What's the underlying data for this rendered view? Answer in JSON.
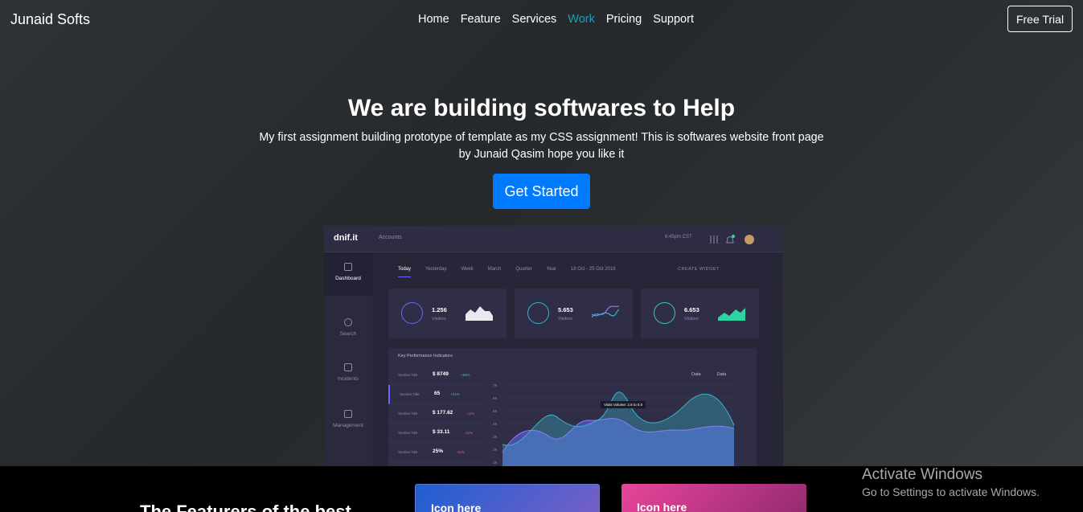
{
  "nav": {
    "brand": "Junaid Softs",
    "items": [
      "Home",
      "Feature",
      "Services",
      "Work",
      "Pricing",
      "Support"
    ],
    "active_item": "Work",
    "trial_label": "Free Trial"
  },
  "hero": {
    "title": "We are building softwares to Help",
    "subtitle": "My first assignment building prototype of template as my CSS assignment! This is softwares website front page by Junaid Qasim hope you like it",
    "cta_label": "Get Started"
  },
  "dashboard": {
    "logo": "dnif.it",
    "breadcrumb": "Accounts",
    "time": "6:45pm CST",
    "sidebar": [
      "Dashboard",
      "Search",
      "Incidents",
      "Management"
    ],
    "tabs": [
      "Today",
      "Yesterday",
      "Week",
      "March",
      "Quarter",
      "Year"
    ],
    "date_range": "18 Oct - 25 Oct 2018",
    "widget_button": "CREATE WIDGET",
    "cards": [
      {
        "value": "1.256",
        "label": "Visitors",
        "color": "#6c63ff"
      },
      {
        "value": "5.653",
        "label": "Visitors",
        "color": "#38b2c9"
      },
      {
        "value": "6.653",
        "label": "Visitors",
        "color": "#2ed3a4"
      }
    ],
    "kpi": {
      "title": "Key Performance Indicators",
      "rows": [
        {
          "title": "Section Title",
          "value": "$ 8749",
          "change": "+54%",
          "color": "#2ed3a4"
        },
        {
          "title": "Section Title",
          "value": "65",
          "change": "+21%",
          "color": "#2ed3a4"
        },
        {
          "title": "Section Title",
          "value": "$ 177.62",
          "change": "-11%",
          "color": "#ff5a5a"
        },
        {
          "title": "Section Title",
          "value": "$ 33.11",
          "change": "-11%",
          "color": "#ff5a5a"
        },
        {
          "title": "Section Title",
          "value": "25%",
          "change": "-11%",
          "color": "#ff5a5a"
        }
      ],
      "legend": [
        "Data",
        "Data"
      ],
      "tooltip": "Visits Volume: 2.6 to 5.0",
      "y_ticks": [
        "7K",
        "6K",
        "5K",
        "4K",
        "3K",
        "2K",
        "1K"
      ]
    }
  },
  "features": {
    "title": "The Featurers of the best",
    "cards": [
      {
        "label": "Icon here",
        "color_from": "#1e5fd1",
        "color_to": "#7b5fc7"
      },
      {
        "label": "Icon here",
        "color_from": "#e8459a",
        "color_to": "#8f2a6e"
      }
    ]
  },
  "watermark": {
    "title": "Activate Windows",
    "subtitle": "Go to Settings to activate Windows."
  }
}
